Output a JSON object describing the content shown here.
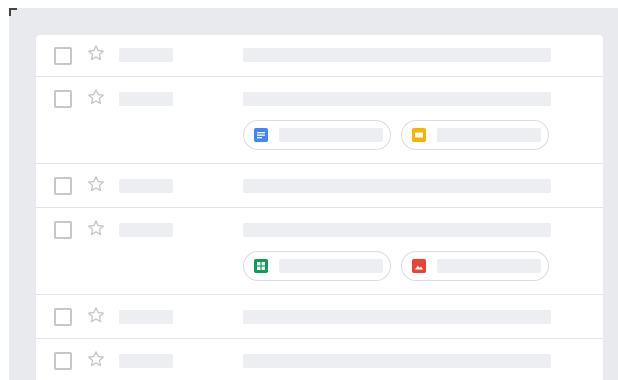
{
  "window": {
    "title": ""
  },
  "inbox": {
    "rows": [
      {
        "sender": "",
        "subject": "",
        "attachments": []
      },
      {
        "sender": "",
        "subject": "",
        "attachments": [
          {
            "type": "document",
            "icon": "docs-icon",
            "color": "#4285f4",
            "name": ""
          },
          {
            "type": "presentation",
            "icon": "slides-icon",
            "color": "#f4b400",
            "name": ""
          }
        ]
      },
      {
        "sender": "",
        "subject": "",
        "attachments": []
      },
      {
        "sender": "",
        "subject": "",
        "attachments": [
          {
            "type": "spreadsheet",
            "icon": "sheets-icon",
            "color": "#0f9d58",
            "name": ""
          },
          {
            "type": "image",
            "icon": "image-icon",
            "color": "#ea4335",
            "name": ""
          }
        ]
      },
      {
        "sender": "",
        "subject": "",
        "attachments": []
      },
      {
        "sender": "",
        "subject": "",
        "attachments": []
      }
    ]
  },
  "colors": {
    "background": "#e9eaee",
    "placeholder": "#eceef1",
    "divider": "#e3e4e8"
  }
}
